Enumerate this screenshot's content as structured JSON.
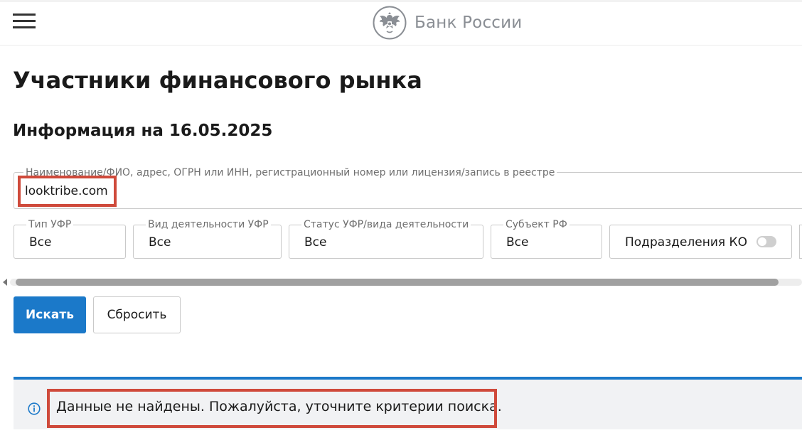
{
  "header": {
    "logo_text": "Банк России",
    "menu_icon": "hamburger-menu-icon",
    "logo_icon": "double-headed-eagle-emblem-icon"
  },
  "page": {
    "title": "Участники финансового рынка",
    "info_date": "Информация на 16.05.2025"
  },
  "search": {
    "label": "Наименование/ФИО, адрес, ОГРН или ИНН, регистрационный номер или лицензия/запись в реестре",
    "value": "looktribe.com"
  },
  "filters": [
    {
      "label": "Тип УФР",
      "value": "Все"
    },
    {
      "label": "Вид деятельности УФР",
      "value": "Все"
    },
    {
      "label": "Статус УФР/вида деятельности",
      "value": "Все"
    },
    {
      "label": "Субъект РФ",
      "value": "Все"
    }
  ],
  "toggle": {
    "label": "Подразделения КО",
    "on": false
  },
  "buttons": {
    "search": "Искать",
    "reset": "Сбросить"
  },
  "message": {
    "text": "Данные не найдены. Пожалуйста, уточните критерии поиска.",
    "icon": "info-circle-icon"
  },
  "colors": {
    "accent": "#1b79c9",
    "highlight": "#cf4a3b",
    "logo_text": "#8a8e94"
  }
}
